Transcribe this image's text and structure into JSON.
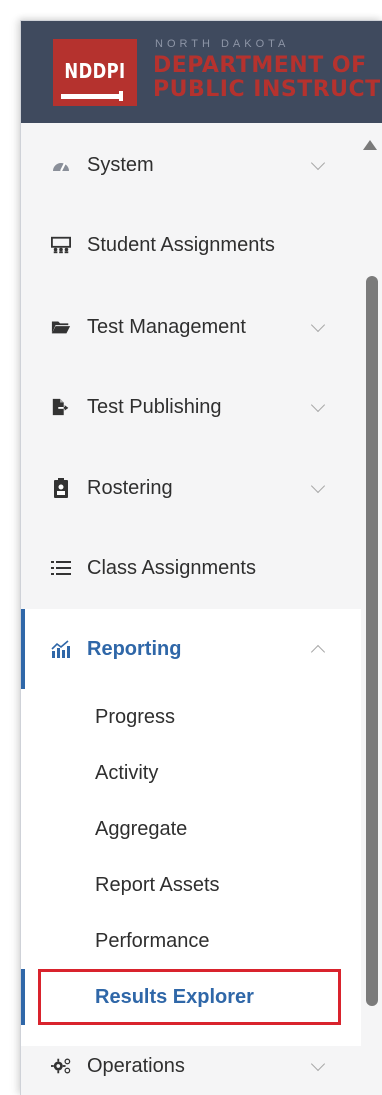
{
  "header": {
    "logo_text": "NDDPI",
    "agency_small": "NORTH DAKOTA",
    "agency_line1": "DEPARTMENT OF",
    "agency_line2": "PUBLIC INSTRUCTIO"
  },
  "nav": {
    "items": [
      {
        "label": "System",
        "icon": "gauge-icon",
        "expandable": true
      },
      {
        "label": "Student Assignments",
        "icon": "students-icon",
        "expandable": false
      },
      {
        "label": "Test Management",
        "icon": "folder-icon",
        "expandable": true
      },
      {
        "label": "Test Publishing",
        "icon": "file-export-icon",
        "expandable": true
      },
      {
        "label": "Rostering",
        "icon": "clipboard-icon",
        "expandable": true
      },
      {
        "label": "Class Assignments",
        "icon": "list-icon",
        "expandable": false
      },
      {
        "label": "Reporting",
        "icon": "chart-bar-icon",
        "expandable": true,
        "expanded": true
      },
      {
        "label": "Operations",
        "icon": "gears-icon",
        "expandable": true
      }
    ],
    "reporting_sub": [
      {
        "label": "Progress"
      },
      {
        "label": "Activity"
      },
      {
        "label": "Aggregate"
      },
      {
        "label": "Report Assets"
      },
      {
        "label": "Performance"
      },
      {
        "label": "Results Explorer",
        "selected": true
      }
    ]
  },
  "colors": {
    "header_bg": "#3f4a5e",
    "brand_red": "#b5322e",
    "accent_blue": "#2f67a8",
    "highlight_red": "#d9232d"
  }
}
